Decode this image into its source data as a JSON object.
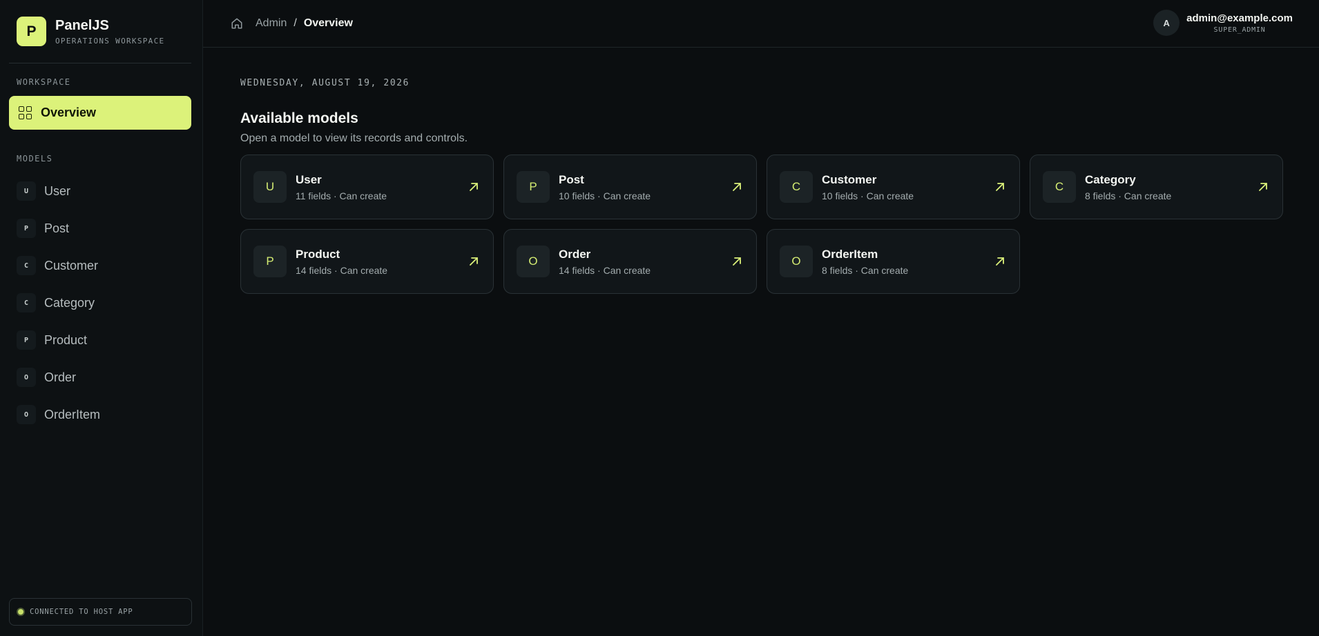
{
  "brand": {
    "logo_letter": "P",
    "name": "PanelJS",
    "subtitle": "OPERATIONS WORKSPACE"
  },
  "sidebar": {
    "workspace_label": "WORKSPACE",
    "active_item": {
      "label": "Overview",
      "icon": "grid-icon"
    },
    "models_label": "MODELS",
    "models": [
      {
        "badge": "U",
        "label": "User"
      },
      {
        "badge": "P",
        "label": "Post"
      },
      {
        "badge": "C",
        "label": "Customer"
      },
      {
        "badge": "C",
        "label": "Category"
      },
      {
        "badge": "P",
        "label": "Product"
      },
      {
        "badge": "O",
        "label": "Order"
      },
      {
        "badge": "O",
        "label": "OrderItem"
      }
    ],
    "status_text": "CONNECTED TO HOST APP"
  },
  "header": {
    "breadcrumb": {
      "root": "Admin",
      "separator": "/",
      "current": "Overview"
    },
    "user": {
      "avatar_letter": "A",
      "email": "admin@example.com",
      "role": "SUPER_ADMIN"
    }
  },
  "main": {
    "date": "WEDNESDAY, AUGUST 19, 2026",
    "title": "Available models",
    "description": "Open a model to view its records and controls.",
    "cards": [
      {
        "badge": "U",
        "title": "User",
        "meta": "11 fields · Can create"
      },
      {
        "badge": "P",
        "title": "Post",
        "meta": "10 fields · Can create"
      },
      {
        "badge": "C",
        "title": "Customer",
        "meta": "10 fields · Can create"
      },
      {
        "badge": "C",
        "title": "Category",
        "meta": "8 fields · Can create"
      },
      {
        "badge": "P",
        "title": "Product",
        "meta": "14 fields · Can create"
      },
      {
        "badge": "O",
        "title": "Order",
        "meta": "14 fields · Can create"
      },
      {
        "badge": "O",
        "title": "OrderItem",
        "meta": "8 fields · Can create"
      }
    ]
  },
  "colors": {
    "accent": "#dcf27a",
    "background": "#0b0e10",
    "card": "#111619",
    "border": "#2a3236"
  }
}
